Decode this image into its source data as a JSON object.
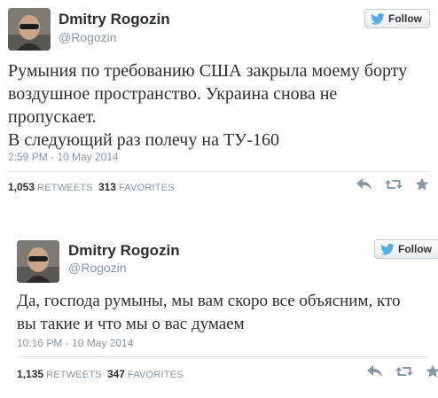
{
  "tweets": [
    {
      "author_name": "Dmitry Rogozin",
      "author_handle": "@Rogozin",
      "follow_label": "Follow",
      "text_lines": [
        "Румыния по требованию США закрыла моему борту",
        "воздушное пространство.  Украина снова не",
        "пропускает.",
        "В следующий раз полечу на ТУ-160"
      ],
      "timestamp": "2:59 PM - 10 May 2014",
      "retweets_count": "1,053",
      "retweets_label": "RETWEETS",
      "favorites_count": "313",
      "favorites_label": "FAVORITES"
    },
    {
      "author_name": "Dmitry Rogozin",
      "author_handle": "@Rogozin",
      "follow_label": "Follow",
      "text_lines": [
        "Да, господа румыны, мы вам скоро все объясним, кто",
        "вы такие и что мы о вас думаем"
      ],
      "timestamp": "10:16 PM - 10 May 2014",
      "retweets_count": "1,135",
      "retweets_label": "RETWEETS",
      "favorites_count": "347",
      "favorites_label": "FAVORITES"
    }
  ],
  "icons": {
    "follow": "twitter-bird-icon",
    "reply": "reply-icon",
    "retweet": "retweet-icon",
    "favorite": "star-icon"
  },
  "colors": {
    "twitter_blue": "#55acee",
    "icon_gray": "#8899a6",
    "text": "#292f33"
  }
}
